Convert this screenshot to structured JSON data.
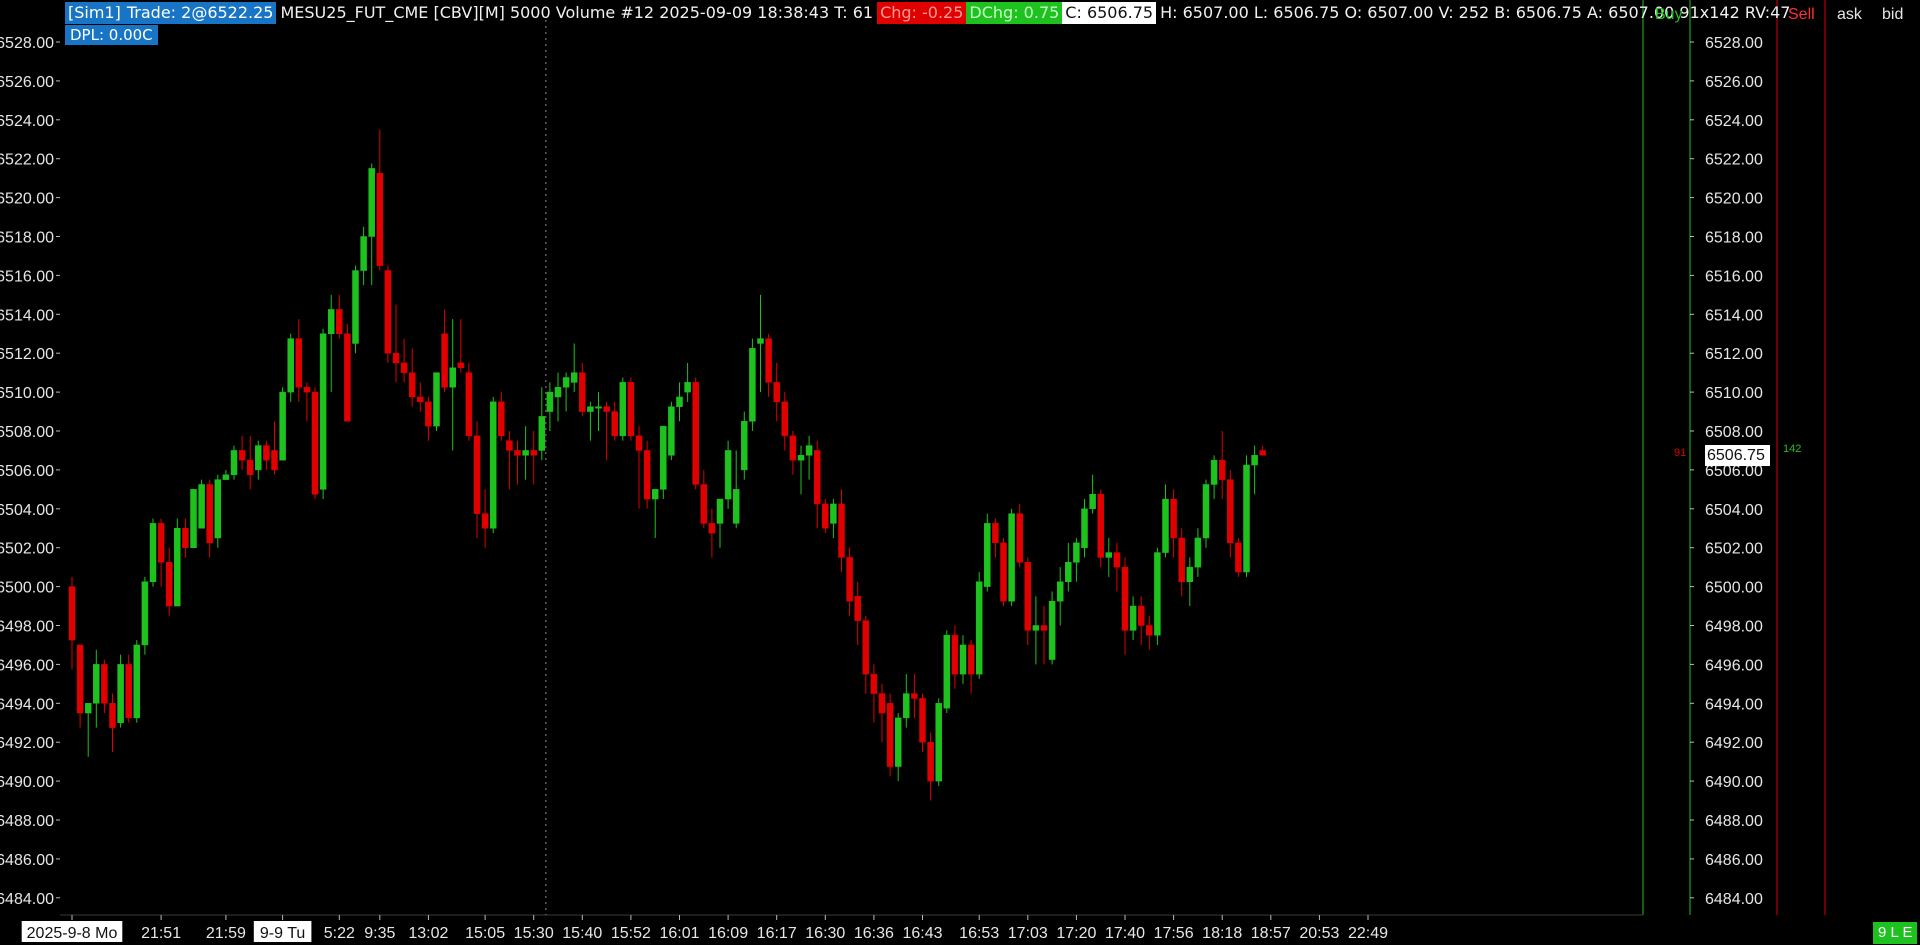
{
  "header": {
    "account": "[Sim1]",
    "trade": "Trade: 2@6522.25",
    "info": "MESU25_FUT_CME [CBV][M]  5000 Volume #12 2025-09-09 18:38:43 T: 61",
    "chg": "Chg: -0.25",
    "dchg": "DChg: 0.75",
    "close": "C: 6506.75",
    "ohlc": "H: 6507.00 L: 6506.75 O: 6507.00 V: 252 B: 6506.75 A: 6507.00 91x142 RV:47"
  },
  "dpl": "DPL: 0.00C",
  "ladder": {
    "buy": "Buy",
    "sell": "Sell",
    "ask": "ask",
    "bid": "bid",
    "bid_size": "91",
    "ask_size": "142"
  },
  "current_price": "6506.75",
  "status_badge": "9 L E",
  "date_labels": [
    "2025-9-8 Mo",
    "9-9 Tu"
  ],
  "colors": {
    "up": "#1ec21e",
    "down": "#e00000",
    "background": "#000000",
    "text": "#e6e6e6"
  },
  "chart_data": {
    "type": "candlestick",
    "ylim": [
      6483,
      6529.5
    ],
    "y_ticks": [
      "6528.00",
      "6526.00",
      "6524.00",
      "6522.00",
      "6520.00",
      "6518.00",
      "6516.00",
      "6514.00",
      "6512.00",
      "6510.00",
      "6508.00",
      "6506.00",
      "6504.00",
      "6502.00",
      "6500.00",
      "6498.00",
      "6496.00",
      "6494.00",
      "6492.00",
      "6490.00",
      "6488.00",
      "6486.00",
      "6484.00"
    ],
    "x_ticks": [
      {
        "label": "2025-9-8 Mo",
        "bar": 0
      },
      {
        "label": "21:51",
        "bar": 11
      },
      {
        "label": "21:59",
        "bar": 19
      },
      {
        "label": "9-9 Tu",
        "bar": 26
      },
      {
        "label": "5:22",
        "bar": 33
      },
      {
        "label": "9:35",
        "bar": 38
      },
      {
        "label": "13:02",
        "bar": 44
      },
      {
        "label": "15:05",
        "bar": 51
      },
      {
        "label": "15:30",
        "bar": 57
      },
      {
        "label": "15:40",
        "bar": 63
      },
      {
        "label": "15:52",
        "bar": 69
      },
      {
        "label": "16:01",
        "bar": 75
      },
      {
        "label": "16:09",
        "bar": 81
      },
      {
        "label": "16:17",
        "bar": 87
      },
      {
        "label": "16:30",
        "bar": 93
      },
      {
        "label": "16:36",
        "bar": 99
      },
      {
        "label": "16:43",
        "bar": 105
      },
      {
        "label": "16:53",
        "bar": 112
      },
      {
        "label": "17:03",
        "bar": 118
      },
      {
        "label": "17:20",
        "bar": 124
      },
      {
        "label": "17:40",
        "bar": 130
      },
      {
        "label": "17:56",
        "bar": 136
      },
      {
        "label": "18:18",
        "bar": 142
      },
      {
        "label": "18:57",
        "bar": 148
      },
      {
        "label": "20:53",
        "bar": 154
      },
      {
        "label": "22:49",
        "bar": 160
      }
    ],
    "session_divider_bar": 58.5,
    "ohlc": [
      [
        6500,
        6500.5,
        6495.75,
        6497.25
      ],
      [
        6497,
        6497,
        6492.75,
        6493.5
      ],
      [
        6493.5,
        6494,
        6491.25,
        6494
      ],
      [
        6494,
        6496.75,
        6492.75,
        6496
      ],
      [
        6496,
        6496.25,
        6493.5,
        6494
      ],
      [
        6494,
        6494.5,
        6491.5,
        6492.75
      ],
      [
        6493,
        6496.5,
        6492.75,
        6496
      ],
      [
        6496,
        6496.5,
        6493,
        6493.25
      ],
      [
        6493.25,
        6497.25,
        6493,
        6497
      ],
      [
        6497,
        6500.5,
        6496.5,
        6500.25
      ],
      [
        6500.25,
        6503.5,
        6500,
        6503.25
      ],
      [
        6503.25,
        6503.5,
        6500,
        6501.25
      ],
      [
        6501.25,
        6502,
        6498.5,
        6499
      ],
      [
        6499,
        6503.5,
        6499,
        6503
      ],
      [
        6503,
        6503.5,
        6501.5,
        6502
      ],
      [
        6502,
        6504,
        6502,
        6505
      ],
      [
        6503,
        6505.5,
        6503,
        6505.25
      ],
      [
        6505.25,
        6505.5,
        6501.5,
        6502.25
      ],
      [
        6502.5,
        6505.75,
        6502,
        6505.5
      ],
      [
        6505.5,
        6506,
        6505.5,
        6505.75
      ],
      [
        6505.75,
        6507.25,
        6505.5,
        6507
      ],
      [
        6507,
        6507.75,
        6506,
        6506.5
      ],
      [
        6506.5,
        6507.75,
        6505,
        6505.75
      ],
      [
        6506,
        6507.5,
        6505.5,
        6507.25
      ],
      [
        6507.25,
        6507.5,
        6506,
        6506.5
      ],
      [
        6507,
        6508.5,
        6505.75,
        6506
      ],
      [
        6506.5,
        6510.25,
        6506.5,
        6510
      ],
      [
        6510,
        6513,
        6509.5,
        6512.75
      ],
      [
        6512.75,
        6513.75,
        6509.5,
        6510.25
      ],
      [
        6510.25,
        6510.5,
        6508.5,
        6510
      ],
      [
        6510,
        6510.25,
        6504.5,
        6504.75
      ],
      [
        6505,
        6513.25,
        6504.5,
        6513
      ],
      [
        6513,
        6515,
        6510,
        6514.25
      ],
      [
        6514.25,
        6515,
        6512.75,
        6513
      ],
      [
        6513,
        6513.5,
        6508.5,
        6508.5
      ],
      [
        6512.5,
        6516.5,
        6512,
        6516.25
      ],
      [
        6516.25,
        6518.5,
        6515.5,
        6518
      ],
      [
        6518,
        6521.75,
        6515.5,
        6521.5
      ],
      [
        6521.25,
        6523.5,
        6516.25,
        6516.5
      ],
      [
        6516.25,
        6516.5,
        6511.5,
        6512
      ],
      [
        6512,
        6514.5,
        6510.5,
        6511.5
      ],
      [
        6511.5,
        6512.75,
        6510.5,
        6511
      ],
      [
        6511,
        6512.25,
        6509.25,
        6509.75
      ],
      [
        6509.75,
        6510.5,
        6509,
        6509.5
      ],
      [
        6509.5,
        6509.75,
        6507.5,
        6508.25
      ],
      [
        6508.25,
        6510.5,
        6508,
        6511
      ],
      [
        6513,
        6514.25,
        6510,
        6510.25
      ],
      [
        6510.25,
        6513.75,
        6507,
        6511.25
      ],
      [
        6511.5,
        6513.75,
        6511,
        6511.25
      ],
      [
        6511,
        6511.5,
        6507.5,
        6507.75
      ],
      [
        6507.75,
        6508.5,
        6502.5,
        6503.75
      ],
      [
        6503.75,
        6505,
        6502,
        6503
      ],
      [
        6503,
        6509.75,
        6502.75,
        6509.5
      ],
      [
        6509.5,
        6510,
        6507.5,
        6507.75
      ],
      [
        6507.5,
        6508,
        6505,
        6507
      ],
      [
        6507,
        6507.5,
        6505.25,
        6506.75
      ],
      [
        6506.75,
        6508.25,
        6505.5,
        6507
      ],
      [
        6507,
        6508,
        6505.25,
        6506.75
      ],
      [
        6507,
        6510.25,
        6506.5,
        6508.75
      ],
      [
        6509,
        6510.5,
        6508,
        6510
      ],
      [
        6509.75,
        6511,
        6508.5,
        6510.25
      ],
      [
        6510.25,
        6511,
        6509,
        6510.75
      ],
      [
        6510.5,
        6512.5,
        6510,
        6511
      ],
      [
        6511,
        6511.5,
        6508.75,
        6509
      ],
      [
        6509,
        6509.5,
        6507.5,
        6509.25
      ],
      [
        6509.25,
        6510,
        6508,
        6509.25
      ],
      [
        6509.25,
        6509.5,
        6506.5,
        6509
      ],
      [
        6509,
        6509.5,
        6507.5,
        6507.75
      ],
      [
        6507.75,
        6510.75,
        6507.5,
        6510.5
      ],
      [
        6510.5,
        6510.75,
        6507.5,
        6507.75
      ],
      [
        6507.75,
        6508.25,
        6504,
        6507
      ],
      [
        6507,
        6507.5,
        6504,
        6504.5
      ],
      [
        6504.5,
        6505,
        6502.5,
        6505
      ],
      [
        6505,
        6508,
        6504.5,
        6508.25
      ],
      [
        6506.75,
        6509.5,
        6506.5,
        6509.25
      ],
      [
        6509.25,
        6510.5,
        6508.5,
        6509.75
      ],
      [
        6510,
        6511.5,
        6509.5,
        6510.5
      ],
      [
        6510.5,
        6510.75,
        6505,
        6505.25
      ],
      [
        6505.25,
        6506,
        6503,
        6503.25
      ],
      [
        6503.25,
        6504,
        6501.5,
        6502.75
      ],
      [
        6503.25,
        6504.5,
        6502,
        6504.5
      ],
      [
        6504.5,
        6507.5,
        6504,
        6507
      ],
      [
        6503.25,
        6507,
        6503,
        6505
      ],
      [
        6506,
        6509,
        6505.5,
        6508.5
      ],
      [
        6508.5,
        6512.75,
        6508,
        6512.25
      ],
      [
        6512.5,
        6515,
        6510,
        6512.75
      ],
      [
        6512.75,
        6513,
        6509.75,
        6510.5
      ],
      [
        6510.5,
        6511.5,
        6508.5,
        6509.5
      ],
      [
        6509.5,
        6510,
        6507,
        6507.75
      ],
      [
        6507.75,
        6508,
        6505.75,
        6506.5
      ],
      [
        6506.5,
        6507.25,
        6504.75,
        6506.75
      ],
      [
        6506.75,
        6507.75,
        6505.5,
        6507.25
      ],
      [
        6507,
        6507.5,
        6503,
        6504.25
      ],
      [
        6504.25,
        6504.5,
        6502.75,
        6503
      ],
      [
        6503.25,
        6504.5,
        6502.5,
        6504.25
      ],
      [
        6504.25,
        6505,
        6500.75,
        6501.5
      ],
      [
        6501.5,
        6502,
        6498.5,
        6499.25
      ],
      [
        6499.5,
        6500.25,
        6497,
        6498.25
      ],
      [
        6498.25,
        6498.5,
        6494.5,
        6495.5
      ],
      [
        6495.5,
        6496,
        6493,
        6494.5
      ],
      [
        6494.5,
        6495,
        6492,
        6493.5
      ],
      [
        6494,
        6494.5,
        6490.25,
        6490.75
      ],
      [
        6490.75,
        6493.5,
        6490,
        6493.25
      ],
      [
        6493.25,
        6495.5,
        6492.75,
        6494.5
      ],
      [
        6494.5,
        6495.5,
        6493.25,
        6494.25
      ],
      [
        6494.25,
        6494.5,
        6491.5,
        6492
      ],
      [
        6492,
        6492.5,
        6489,
        6490
      ],
      [
        6490,
        6494.25,
        6489.75,
        6494
      ],
      [
        6493.75,
        6497.75,
        6493.5,
        6497.5
      ],
      [
        6497.5,
        6498,
        6494.75,
        6495.5
      ],
      [
        6495.5,
        6497.5,
        6495,
        6497
      ],
      [
        6497,
        6497.25,
        6494.5,
        6495.5
      ],
      [
        6495.5,
        6500.75,
        6495.25,
        6500.25
      ],
      [
        6500,
        6503.75,
        6499.75,
        6503.25
      ],
      [
        6503.25,
        6503.5,
        6501.5,
        6502.25
      ],
      [
        6502.25,
        6502.5,
        6499,
        6499.25
      ],
      [
        6499.25,
        6504,
        6499,
        6503.75
      ],
      [
        6503.75,
        6504.25,
        6501,
        6501.25
      ],
      [
        6501.25,
        6501.5,
        6497,
        6497.75
      ],
      [
        6497.75,
        6499.5,
        6496,
        6498
      ],
      [
        6498,
        6499,
        6496,
        6497.75
      ],
      [
        6496.25,
        6499.75,
        6496,
        6499.25
      ],
      [
        6499.25,
        6501,
        6498,
        6500.25
      ],
      [
        6500.25,
        6502.25,
        6499.75,
        6501.25
      ],
      [
        6501.25,
        6502.5,
        6500.25,
        6502.25
      ],
      [
        6502,
        6504.5,
        6501.5,
        6504
      ],
      [
        6504,
        6505.75,
        6503.75,
        6504.75
      ],
      [
        6504.75,
        6505,
        6501,
        6501.5
      ],
      [
        6501.5,
        6502.5,
        6500.5,
        6501.75
      ],
      [
        6501.75,
        6502.25,
        6499.75,
        6501
      ],
      [
        6501,
        6501.5,
        6496.5,
        6497.75
      ],
      [
        6497.75,
        6499.5,
        6497.25,
        6499
      ],
      [
        6499,
        6499.5,
        6497,
        6498
      ],
      [
        6498,
        6498.5,
        6496.75,
        6497.5
      ],
      [
        6497.5,
        6502,
        6497,
        6501.75
      ],
      [
        6501.75,
        6505.25,
        6501.5,
        6504.5
      ],
      [
        6504.5,
        6505,
        6501.5,
        6502.5
      ],
      [
        6502.5,
        6503,
        6499.5,
        6500.25
      ],
      [
        6500.25,
        6501.5,
        6499,
        6501
      ],
      [
        6501,
        6503,
        6500.5,
        6502.5
      ],
      [
        6502.5,
        6505.5,
        6502,
        6505.25
      ],
      [
        6505.25,
        6506.75,
        6504.5,
        6506.5
      ],
      [
        6506.5,
        6508,
        6504.5,
        6505.5
      ],
      [
        6505.5,
        6506,
        6501.5,
        6502.25
      ],
      [
        6502.25,
        6502.5,
        6500.5,
        6500.75
      ],
      [
        6500.75,
        6506.75,
        6500.5,
        6506.25
      ],
      [
        6506.25,
        6507.25,
        6504.75,
        6506.75
      ],
      [
        6507,
        6507.25,
        6506.75,
        6506.75
      ]
    ]
  }
}
